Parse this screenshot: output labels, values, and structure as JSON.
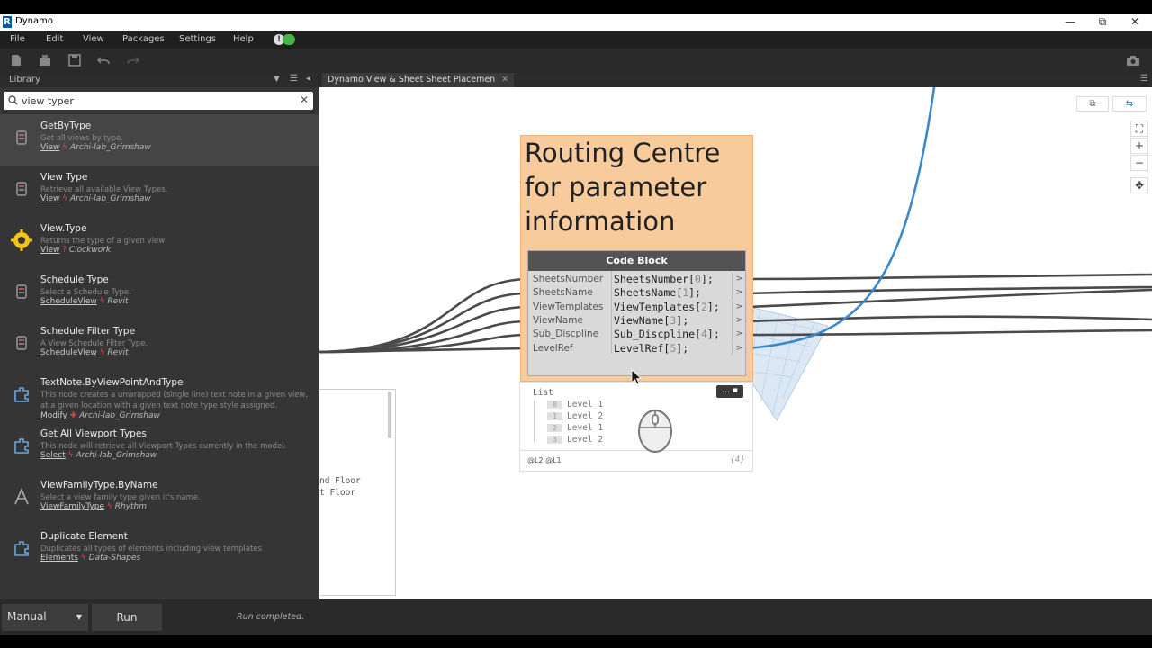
{
  "window": {
    "app_title": "Dynamo",
    "logo_letter": "R",
    "minimize": "—",
    "maximize": "⧉",
    "close": "✕"
  },
  "menu": {
    "file": "File",
    "edit": "Edit",
    "view": "View",
    "packages": "Packages",
    "settings": "Settings",
    "help": "Help"
  },
  "library": {
    "title": "Library",
    "search_value": "view typer",
    "results": [
      {
        "name": "GetByType",
        "desc": "Get all views by type.",
        "category": "View",
        "pkg_icon": "ϟ",
        "package": "Archi-lab_Grimshaw",
        "icon": "node-package-icon"
      },
      {
        "name": "View Type",
        "desc": "Retrieve all available View Types.",
        "category": "View",
        "pkg_icon": "ϟ",
        "package": "Archi-lab_Grimshaw",
        "icon": "node-package-icon"
      },
      {
        "name": "View.Type",
        "desc": "Returns the type of a given view",
        "category": "View",
        "pkg_icon": "?",
        "package": "Clockwork",
        "icon": "clockwork-gear-icon"
      },
      {
        "name": "Schedule Type",
        "desc": "Select a Schedule Type.",
        "category": "ScheduleView",
        "pkg_icon": "ϟ",
        "package": "Revit",
        "icon": "node-package-icon"
      },
      {
        "name": "Schedule Filter Type",
        "desc": "A View Schedule Filter Type.",
        "category": "ScheduleView",
        "pkg_icon": "ϟ",
        "package": "Revit",
        "icon": "node-package-icon"
      },
      {
        "name": "TextNote.ByViewPointAndType",
        "desc": "This node creates a unwrapped (single line) text note in a given view, at a given location with a given text note type style assigned.",
        "category": "Modify",
        "pkg_icon": "✚",
        "package": "Archi-lab_Grimshaw",
        "icon": "custom-node-icon"
      },
      {
        "name": "Get All Viewport Types",
        "desc": "This node will retrieve all Viewport Types currently in the model.",
        "category": "Select",
        "pkg_icon": "ϟ",
        "package": "Archi-lab_Grimshaw",
        "icon": "custom-node-icon"
      },
      {
        "name": "ViewFamilyType.ByName",
        "desc": "Select a view family type given it's name.",
        "category": "ViewFamilyType",
        "pkg_icon": "ϟ",
        "package": "Rhythm",
        "icon": "rhythm-icon"
      },
      {
        "name": "Duplicate Element",
        "desc": "Duplicates all types of elements including view templates",
        "category": "Elements",
        "pkg_icon": "ϟ",
        "package": "Data-Shapes",
        "icon": "custom-node-icon"
      }
    ]
  },
  "workspace": {
    "tab_label": "Dynamo View & Sheet Sheet Placemen",
    "tab_close": "✕"
  },
  "group": {
    "title_line1": "Routing Centre",
    "title_line2": "for parameter",
    "title_line3": "information"
  },
  "code_block": {
    "title": "Code Block",
    "ports": [
      {
        "input": "SheetsNumber",
        "var": "SheetsNumber",
        "index": "0",
        "output": ">"
      },
      {
        "input": "SheetsName",
        "var": "SheetsName",
        "index": "1",
        "output": ">"
      },
      {
        "input": "ViewTemplates",
        "var": "ViewTemplates",
        "index": "2",
        "output": ">"
      },
      {
        "input": "ViewName",
        "var": "ViewName",
        "index": "3",
        "output": ">"
      },
      {
        "input": "Sub_Discpline",
        "var": "Sub_Discpline",
        "index": "4",
        "output": ">"
      },
      {
        "input": "LevelRef",
        "var": "LevelRef",
        "index": "5",
        "output": ">"
      }
    ]
  },
  "preview": {
    "title": "List",
    "items": [
      {
        "idx": "0",
        "value": "Level 1"
      },
      {
        "idx": "1",
        "value": "Level 2"
      },
      {
        "idx": "2",
        "value": "Level 1"
      },
      {
        "idx": "3",
        "value": "Level 2"
      }
    ],
    "levels": "@L2 @L1",
    "count": "{4}",
    "pin_label": "… ▪"
  },
  "side_preview": {
    "line1": "nd Floor",
    "line2": "t Floor"
  },
  "status": {
    "run_mode": "Manual",
    "run_button": "Run",
    "message": "Run completed."
  },
  "colors": {
    "group_bg": "#f8cb9c",
    "wire_blue": "#3a87c9",
    "status_ok": "#47b447"
  }
}
